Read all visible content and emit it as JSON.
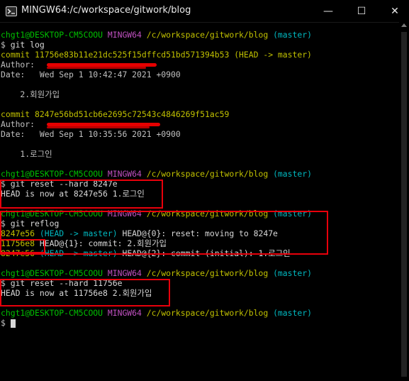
{
  "window": {
    "title": "MINGW64:/c/workspace/gitwork/blog",
    "minimize_glyph": "—",
    "maximize_glyph": "☐",
    "close_glyph": "✕"
  },
  "prompt": {
    "user_host": "chgt1@DESKTOP-CM5COOU",
    "shell": "MINGW64",
    "path": "/c/workspace/gitwork/blog",
    "branch": "(master)",
    "symbol": "$"
  },
  "log": {
    "command": "git log",
    "commit1": {
      "hash_line": "commit 11756e83b11e21dc525f15dffcd51bd571394b53",
      "ref": "(HEAD -> master)",
      "author_label": "Author: ",
      "date_line": "Date:   Wed Sep 1 10:42:47 2021 +0900",
      "message": "    2.회원가입"
    },
    "commit2": {
      "hash_line": "commit 8247e56bd51cb6e2695c72543c4846269f51ac59",
      "author_label": "Author: ",
      "date_line": "Date:   Wed Sep 1 10:35:56 2021 +0900",
      "message": "    1.로그인"
    }
  },
  "reset1": {
    "command": "git reset --hard 8247e",
    "output": "HEAD is now at 8247e56 1.로그인"
  },
  "reflog": {
    "command": "git reflog",
    "entry0": {
      "hash": "8247e56",
      "ref": "(HEAD -> master)",
      "text": " HEAD@{0}: reset: moving to 8247e"
    },
    "entry1": {
      "hash": "11756e8",
      "text": " HEAD@{1}: commit: 2.회원가입"
    },
    "entry2": {
      "hash": "8247e56",
      "ref": "(HEAD -> master)",
      "text": " HEAD@{2}: commit (initial): 1.로그인"
    }
  },
  "reset2": {
    "command": "git reset --hard 11756e",
    "output": "HEAD is now at 11756e8 2.회원가입"
  },
  "colors": {
    "background": "#000000",
    "prompt_green": "#00c000",
    "prompt_magenta": "#c050c0",
    "prompt_yellow": "#c0c000",
    "branch_cyan": "#00b8c0",
    "annotation_red": "#e8000b"
  },
  "icons": {
    "app": "git-bash-icon"
  }
}
